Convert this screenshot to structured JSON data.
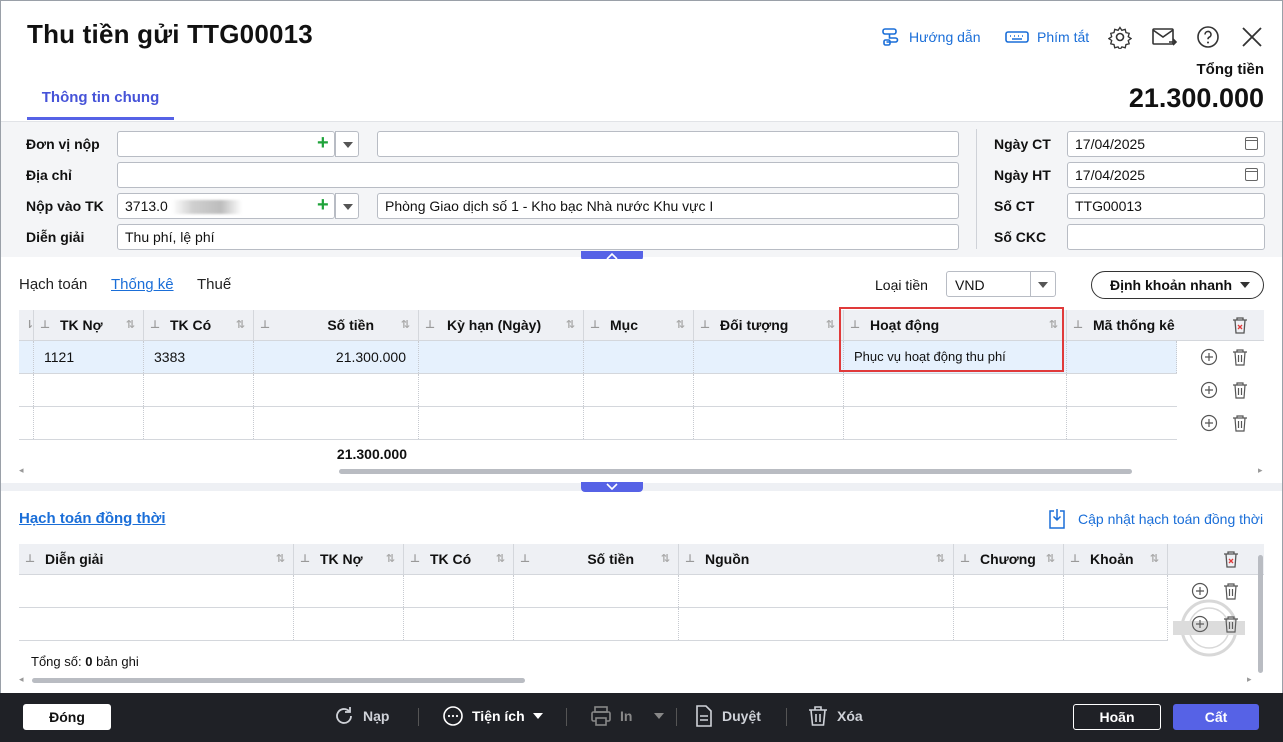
{
  "header": {
    "title": "Thu tiền gửi TTG00013",
    "guide_label": "Hướng dẫn",
    "shortcut_label": "Phím tắt",
    "total_label": "Tổng tiền",
    "total_value": "21.300.000",
    "tab_general": "Thông tin chung"
  },
  "form": {
    "payer_label": "Đơn vị nộp",
    "payer_value": "",
    "payer_name": "",
    "address_label": "Địa chỉ",
    "address_value": "",
    "account_label": "Nộp vào TK",
    "account_value": "3713.0",
    "account_bank": "Phòng Giao dịch số 1 - Kho bạc Nhà nước Khu vực I",
    "description_label": "Diễn giải",
    "description_value": "Thu phí, lệ phí",
    "doc_date_label": "Ngày CT",
    "doc_date_value": "17/04/2025",
    "post_date_label": "Ngày HT",
    "post_date_value": "17/04/2025",
    "doc_no_label": "Số CT",
    "doc_no_value": "TTG00013",
    "ckc_label": "Số CKC",
    "ckc_value": ""
  },
  "detail": {
    "tabs": [
      "Hạch toán",
      "Thống kê",
      "Thuế"
    ],
    "active_tab": "Thống kê",
    "currency_label": "Loại tiền",
    "currency_value": "VND",
    "quick_button": "Định khoản nhanh",
    "columns": [
      "TK Nợ",
      "TK Có",
      "Số tiền",
      "Kỳ hạn (Ngày)",
      "Mục",
      "Đối tượng",
      "Hoạt động",
      "Mã thống kê"
    ],
    "rows": [
      {
        "tk_no": "1121",
        "tk_co": "3383",
        "amount": "21.300.000",
        "term": "",
        "muc": "",
        "doi_tuong": "",
        "hoat_dong": "Phục vụ hoạt động thu phí",
        "ma_tk": ""
      }
    ],
    "total_amount": "21.300.000"
  },
  "simultaneous": {
    "title": "Hạch toán đồng thời",
    "update_label": "Cập nhật hạch toán đồng thời",
    "columns": [
      "Diễn giải",
      "TK Nợ",
      "TK Có",
      "Số tiền",
      "Nguồn",
      "Chương",
      "Khoản"
    ],
    "count_label": "Tổng số:",
    "count_value": "0",
    "count_unit": "bản ghi"
  },
  "footer": {
    "close": "Đóng",
    "reload": "Nạp",
    "utilities": "Tiện ích",
    "print": "In",
    "approve": "Duyệt",
    "delete": "Xóa",
    "cancel": "Hoãn",
    "save": "Cất"
  },
  "colors": {
    "accent": "#5662e6",
    "link": "#1a6ed8",
    "highlight": "#e03a3a",
    "footer": "#1f2126"
  }
}
